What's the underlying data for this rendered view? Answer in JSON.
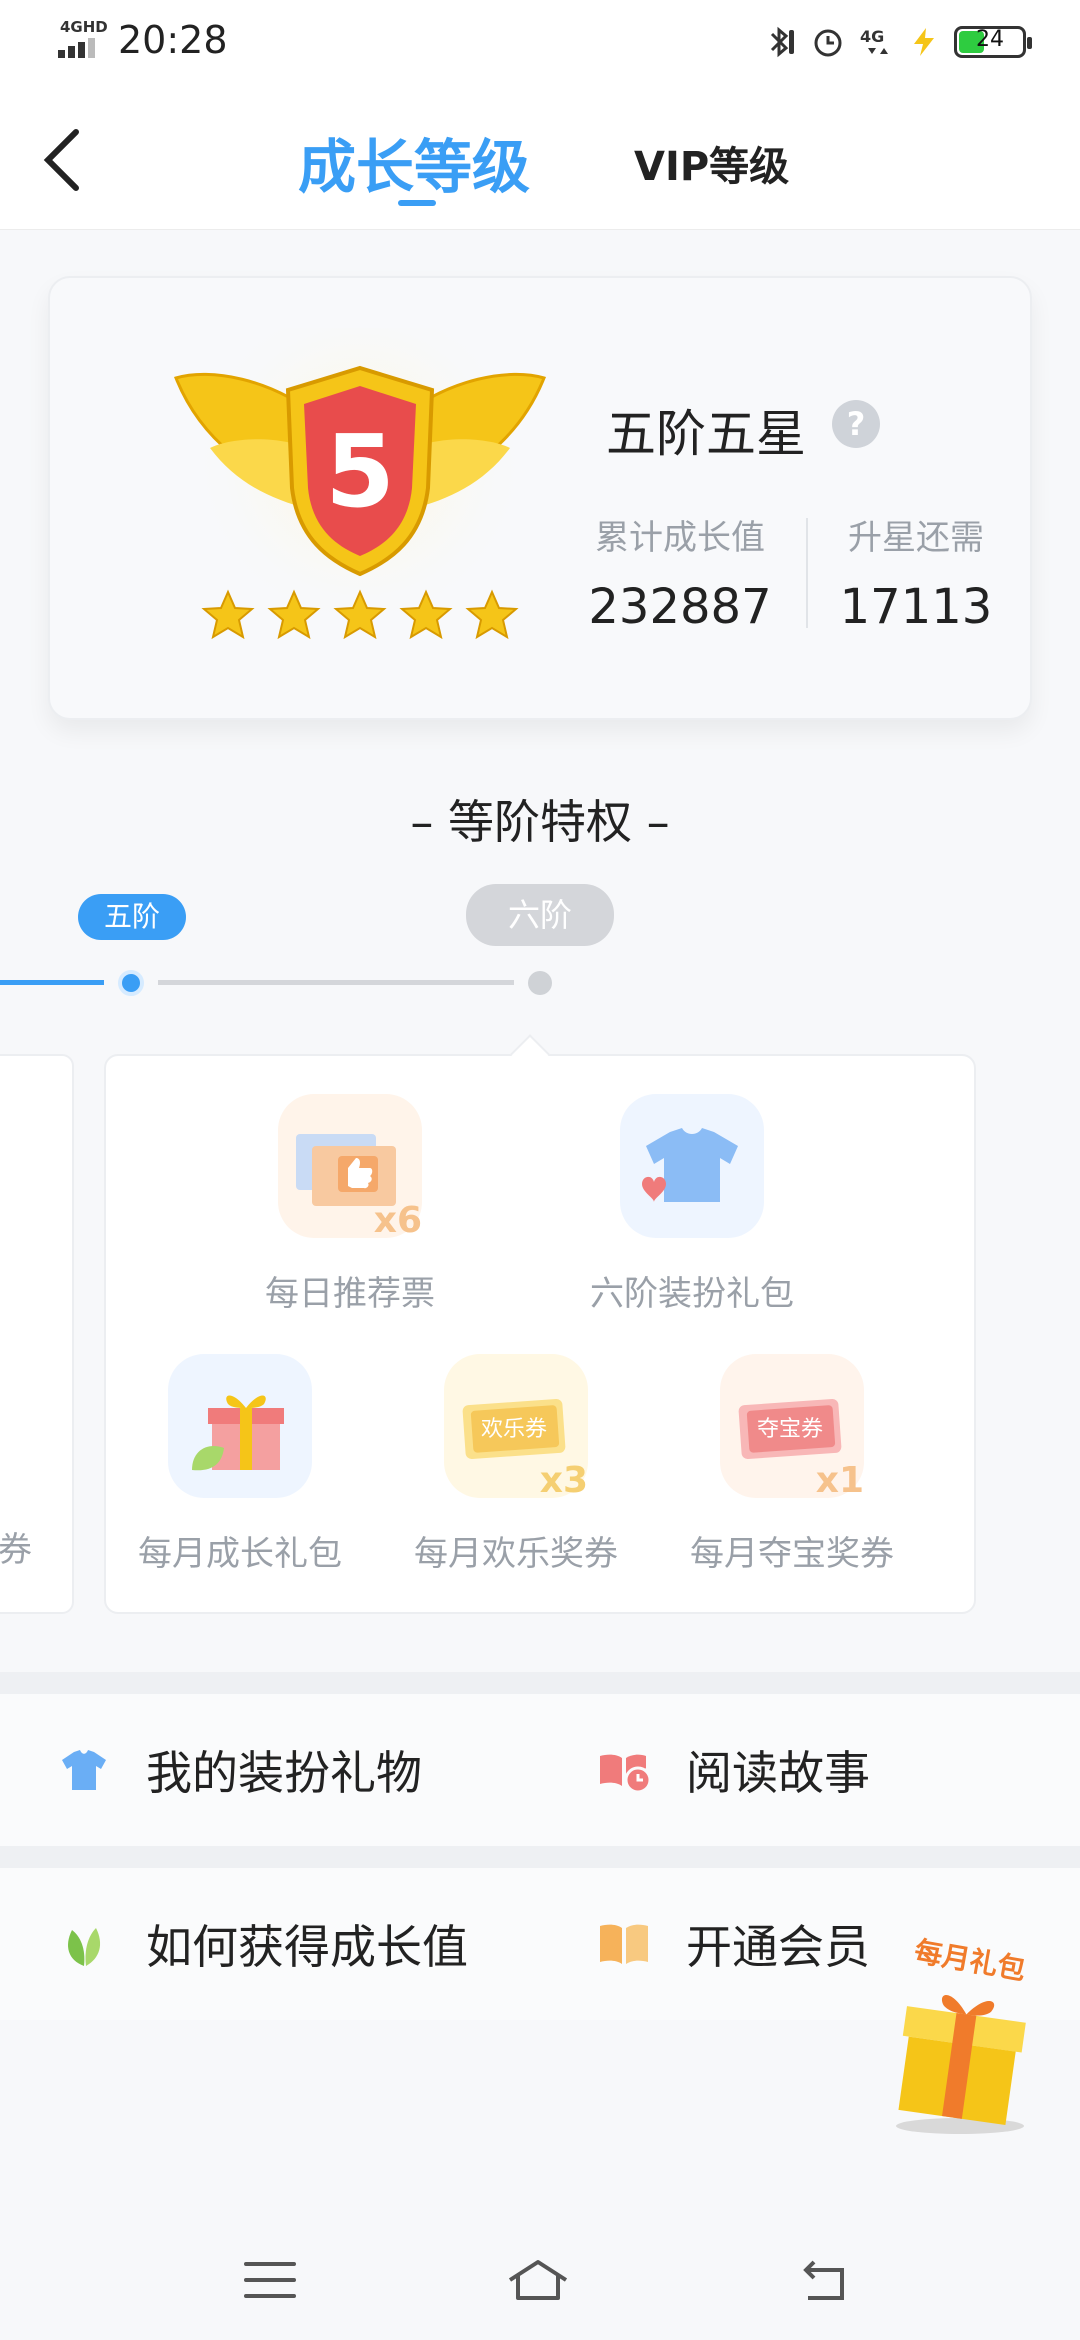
{
  "status_bar": {
    "network": "4GHD",
    "time": "20:28",
    "battery": "24",
    "battery_level_percent": 24,
    "icons": [
      "bluetooth-icon",
      "alarm-icon",
      "4g-icon",
      "charging-icon"
    ]
  },
  "nav": {
    "back_icon": "chevron-left-icon",
    "tab_growth": "成长等级",
    "tab_vip": "VIP等级"
  },
  "level": {
    "badge_number": "5",
    "badge_stars": 5,
    "name": "五阶五星",
    "help": "?",
    "stat1_label": "累计成长值",
    "stat1_value": "232887",
    "stat2_label": "升星还需",
    "stat2_value": "17113"
  },
  "privileges": {
    "title": "– 等阶特权 –",
    "tier_current": "五阶",
    "tier_next": "六阶",
    "prev_card_tail": "券",
    "items": [
      {
        "label": "每日推荐票",
        "multiplier": "x6",
        "icon": "recommend-ticket-icon"
      },
      {
        "label": "六阶装扮礼包",
        "icon": "tshirt-icon"
      },
      {
        "label": "每月成长礼包",
        "icon": "gift-box-icon"
      },
      {
        "label": "每月欢乐奖券",
        "multiplier": "x3",
        "coupon_text": "欢乐券",
        "icon": "happy-coupon-icon"
      },
      {
        "label": "每月夺宝奖券",
        "multiplier": "x1",
        "coupon_text": "夺宝券",
        "icon": "treasure-coupon-icon"
      }
    ]
  },
  "menu": {
    "my_outfit_gifts": "我的装扮礼物",
    "read_story": "阅读故事",
    "how_to_get_growth": "如何获得成长值",
    "open_membership": "开通会员"
  },
  "floating_gift": {
    "label": "每月礼包"
  },
  "colors": {
    "accent": "#3a9ef5",
    "gray": "#9aa0a8",
    "coupon_orange": "#f6a623",
    "coupon_red": "#f07b7b"
  }
}
